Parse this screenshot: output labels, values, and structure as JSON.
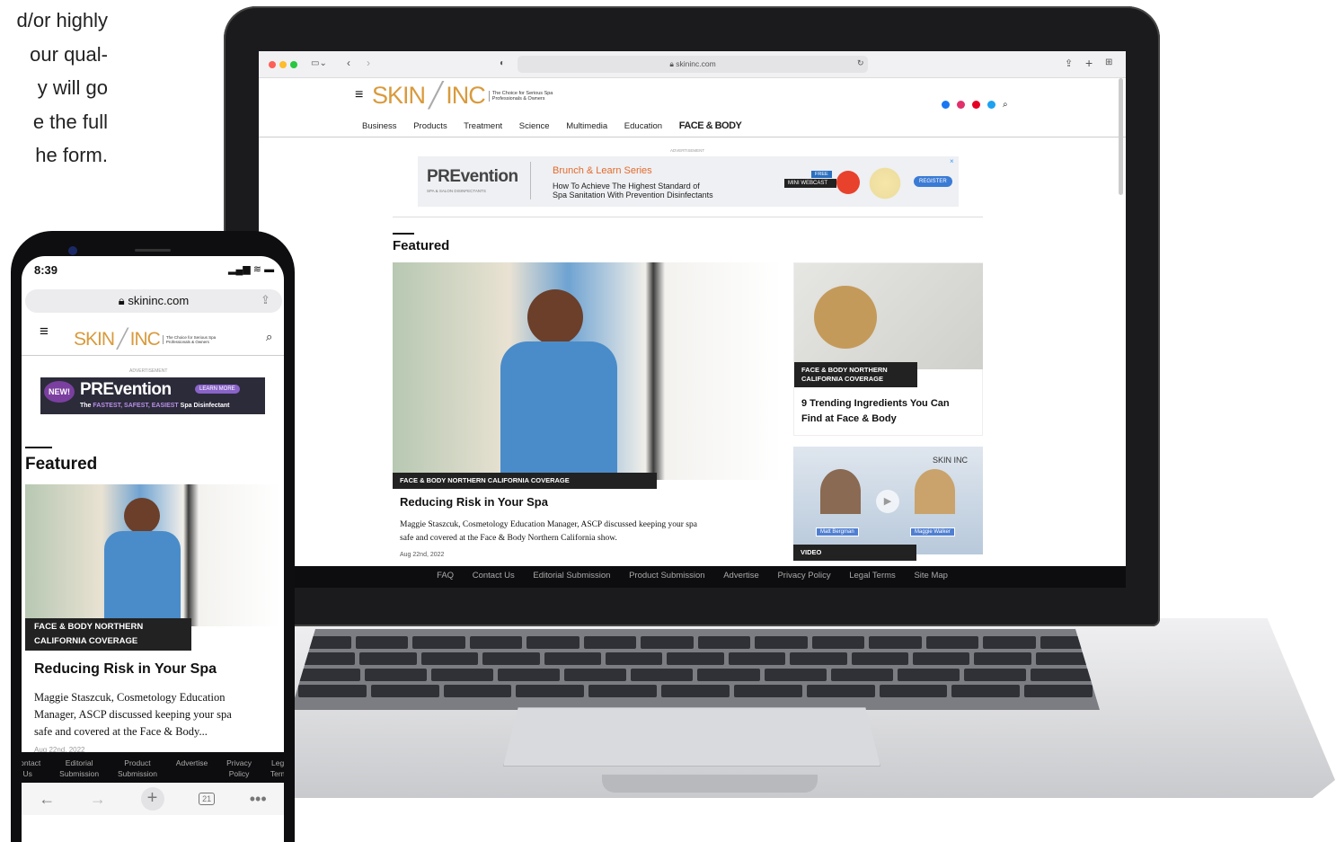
{
  "side_copy": {
    "lines": [
      "d/or highly",
      "our qual-",
      "y will go",
      "e the full",
      "he form."
    ]
  },
  "laptop": {
    "browser": {
      "url": "skininc.com"
    },
    "site": {
      "logo_text": "SKIN",
      "logo_text2": "INC",
      "tagline_1": "The Choice for Serious Spa",
      "tagline_2": "Professionals & Owners",
      "nav": [
        "Business",
        "Products",
        "Treatment",
        "Science",
        "Multimedia",
        "Education"
      ],
      "nav_brand": "FACE & BODY",
      "ad_label": "ADVERTISEMENT",
      "ad": {
        "brand": "PREvention",
        "brand_sub": "SPA & SALON DISINFECTANTS",
        "series": "Brunch & Learn Series",
        "headline_1": "How To Achieve The Highest Standard of",
        "headline_2": "Spa Sanitation With Prevention Disinfectants",
        "free": "FREE",
        "webcast": "MINI WEBCAST",
        "register": "REGISTER",
        "close": "×"
      },
      "section_title": "Featured",
      "main_story": {
        "category": "FACE & BODY NORTHERN CALIFORNIA COVERAGE",
        "title": "Reducing Risk in Your Spa",
        "summary_1": "Maggie Staszcuk, Cosmetology Education Manager, ASCP discussed keeping your spa",
        "summary_2": "safe and covered at the Face & Body Northern California show.",
        "date": "Aug 22nd, 2022"
      },
      "side_story": {
        "category_1": "FACE & BODY NORTHERN",
        "category_2": "CALIFORNIA COVERAGE",
        "title_1": "9 Trending Ingredients You Can",
        "title_2": "Find at Face & Body"
      },
      "video_story": {
        "category": "VIDEO",
        "logo": "SKIN INC",
        "name_left": "Matt Bergman",
        "name_right": "Maggie Walker"
      },
      "footer": [
        "FAQ",
        "Contact Us",
        "Editorial Submission",
        "Product Submission",
        "Advertise",
        "Privacy Policy",
        "Legal Terms",
        "Site Map"
      ]
    }
  },
  "phone": {
    "time": "8:39",
    "url": "skininc.com",
    "ad_label": "ADVERTISEMENT",
    "ad": {
      "badge": "NEW!",
      "brand": "PREvention",
      "cta": "LEARN MORE",
      "line_prefix": "The",
      "line_highlight": "FASTEST, SAFEST, EASIEST",
      "line_suffix": "Spa Disinfectant"
    },
    "section_title": "Featured",
    "story": {
      "category_1": "FACE & BODY NORTHERN",
      "category_2": "CALIFORNIA COVERAGE",
      "title": "Reducing Risk in Your Spa",
      "summary_1": "Maggie Staszcuk, Cosmetology Education",
      "summary_2": "Manager, ASCP discussed keeping your spa",
      "summary_3": "safe and covered at the Face & Body...",
      "date": "Aug 22nd, 2022"
    },
    "footer": [
      [
        "Contact",
        "Us"
      ],
      [
        "Editorial",
        "Submission"
      ],
      [
        "Product",
        "Submission"
      ],
      [
        "Advertise",
        ""
      ],
      [
        "Privacy",
        "Policy"
      ],
      [
        "Legal",
        "Terms"
      ]
    ],
    "tab_count": "21"
  }
}
